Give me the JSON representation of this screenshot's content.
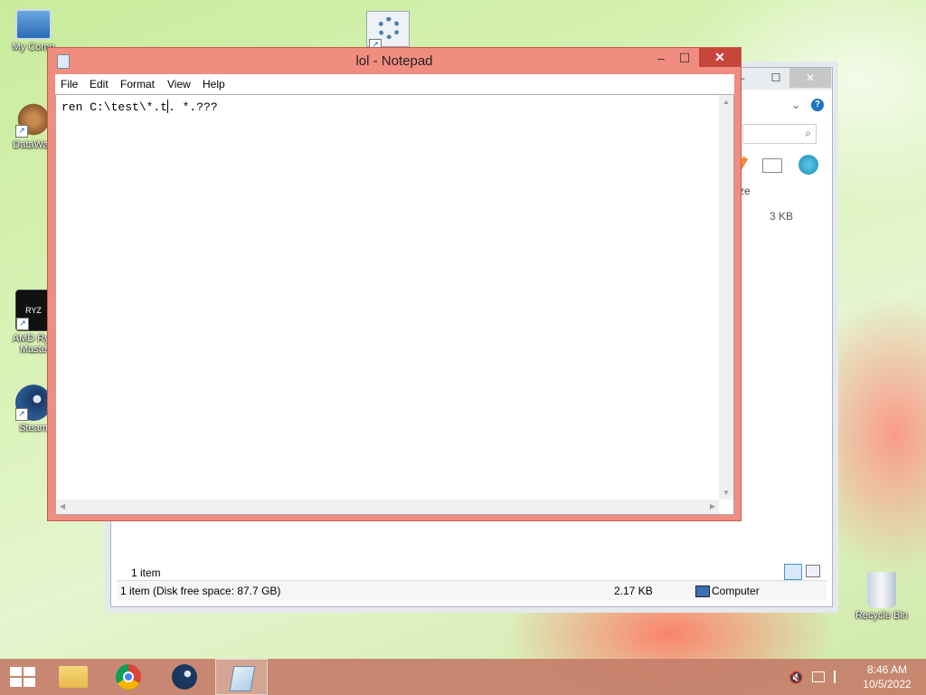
{
  "desktop": {
    "icons": [
      {
        "label": "My Comp",
        "glyph": "computer-icon"
      },
      {
        "label": "DataWag",
        "glyph": "datawagon-icon"
      },
      {
        "label": "AMD Ryz Maste",
        "glyph": "amd-ryzen-icon"
      },
      {
        "label": "Steam",
        "glyph": "steam-icon"
      },
      {
        "label": "Recycle Bin",
        "glyph": "recycle-bin-icon"
      }
    ]
  },
  "explorer": {
    "size_fragment": "ze",
    "file_size": "3 KB",
    "item_count": "1 item",
    "status_left": "1 item (Disk free space: 87.7 GB)",
    "status_mid": "2.17 KB",
    "status_right": "Computer"
  },
  "notepad": {
    "title": "lol - Notepad",
    "menu": [
      "File",
      "Edit",
      "Format",
      "View",
      "Help"
    ],
    "content_before_caret": "ren C:\\test\\*.t",
    "content_after_caret": ". *.???",
    "minimize": "–",
    "maximize": "☐",
    "close": "✕"
  },
  "taskbar": {
    "time": "8:46 AM",
    "date": "10/5/2022"
  },
  "colors": {
    "notepad_frame": "#f08c80",
    "close_button": "#c7463c",
    "taskbar": "#c47e6a"
  }
}
